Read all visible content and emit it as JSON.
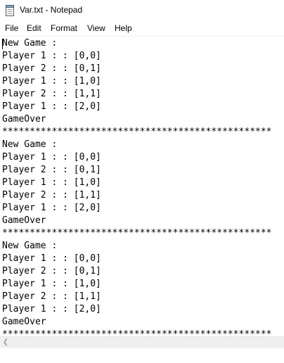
{
  "window": {
    "title": "Var.txt - Notepad"
  },
  "menu": {
    "file": "File",
    "edit": "Edit",
    "format": "Format",
    "view": "View",
    "help": "Help"
  },
  "editor": {
    "lines": [
      "New Game :",
      "Player 1 : : [0,0]",
      "Player 2 : : [0,1]",
      "Player 1 : : [1,0]",
      "Player 2 : : [1,1]",
      "Player 1 : : [2,0]",
      "GameOver",
      "*************************************************",
      "New Game :",
      "Player 1 : : [0,0]",
      "Player 2 : : [0,1]",
      "Player 1 : : [1,0]",
      "Player 2 : : [1,1]",
      "Player 1 : : [2,0]",
      "GameOver",
      "*************************************************",
      "New Game :",
      "Player 1 : : [0,0]",
      "Player 2 : : [0,1]",
      "Player 1 : : [1,0]",
      "Player 2 : : [1,1]",
      "Player 1 : : [2,0]",
      "GameOver",
      "*************************************************"
    ]
  },
  "icons": {
    "app_icon": "notepad-icon",
    "scroll_left": "chevron-left-icon"
  }
}
